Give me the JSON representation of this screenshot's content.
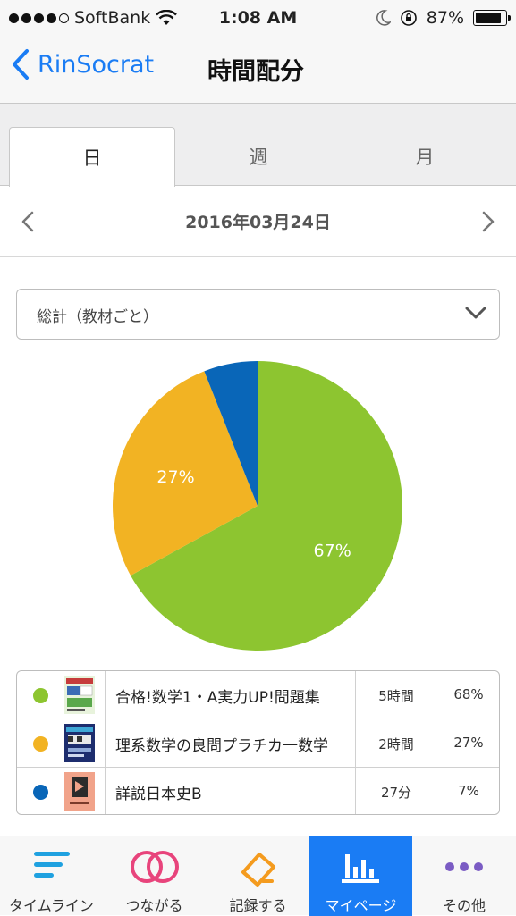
{
  "status": {
    "carrier": "SoftBank",
    "time": "1:08 AM",
    "battery": "87%"
  },
  "nav": {
    "back_label": "RinSocrat",
    "title": "時間配分"
  },
  "tabs": [
    {
      "label": "日",
      "active": true
    },
    {
      "label": "週",
      "active": false
    },
    {
      "label": "月",
      "active": false
    }
  ],
  "date": "2016年03月24日",
  "select": {
    "value": "総計（教材ごと）"
  },
  "chart_data": {
    "type": "pie",
    "slices": [
      {
        "label": "67%",
        "value": 67,
        "color": "#8dc530"
      },
      {
        "label": "27%",
        "value": 27,
        "color": "#f2b323"
      },
      {
        "label": "",
        "value": 6,
        "color": "#0966b8"
      }
    ]
  },
  "legend": [
    {
      "color": "#8dc530",
      "title": "合格!数学1・A実力UP!問題集",
      "time": "5時間",
      "pct": "68%"
    },
    {
      "color": "#f2b323",
      "title": "理系数学の良問プラチカ一数学",
      "time": "2時間",
      "pct": "27%"
    },
    {
      "color": "#0966b8",
      "title": "詳説日本史B",
      "time": "27分",
      "pct": "7%"
    }
  ],
  "tabbar": [
    {
      "label": "タイムライン",
      "icon": "timeline-icon",
      "active": false
    },
    {
      "label": "つながる",
      "icon": "connect-icon",
      "active": false
    },
    {
      "label": "記録する",
      "icon": "record-icon",
      "active": false
    },
    {
      "label": "マイページ",
      "icon": "mypage-icon",
      "active": true
    },
    {
      "label": "その他",
      "icon": "more-icon",
      "active": false
    }
  ],
  "colors": {
    "accent": "#1a7cf4",
    "timeline_icon": "#1fa1e0",
    "connect_icon": "#e8447c",
    "record_icon": "#f49b1e",
    "more_icon": "#7b5cc4"
  }
}
